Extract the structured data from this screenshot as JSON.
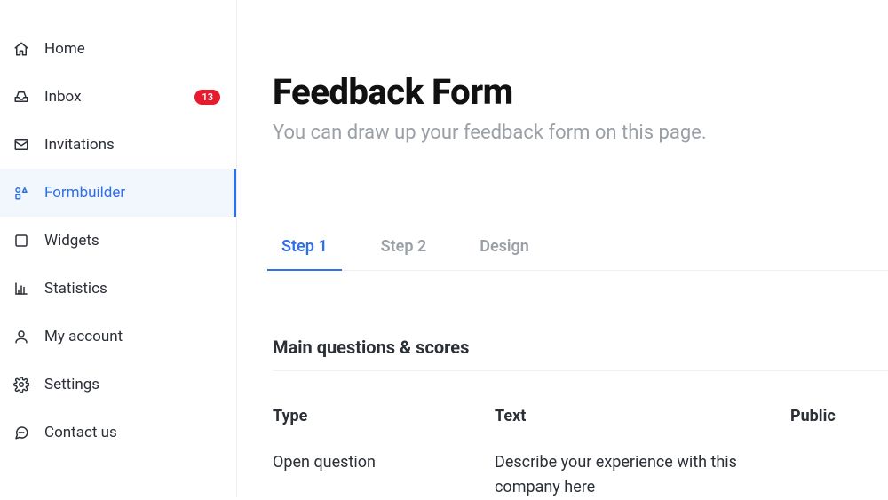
{
  "sidebar": {
    "items": [
      {
        "label": "Home",
        "icon": "home",
        "active": false
      },
      {
        "label": "Inbox",
        "icon": "inbox",
        "active": false,
        "badge": "13"
      },
      {
        "label": "Invitations",
        "icon": "envelope",
        "active": false
      },
      {
        "label": "Formbuilder",
        "icon": "shapes",
        "active": true
      },
      {
        "label": "Widgets",
        "icon": "square",
        "active": false
      },
      {
        "label": "Statistics",
        "icon": "bar-chart",
        "active": false
      },
      {
        "label": "My account",
        "icon": "user",
        "active": false
      },
      {
        "label": "Settings",
        "icon": "gear",
        "active": false
      },
      {
        "label": "Contact us",
        "icon": "chat",
        "active": false
      }
    ]
  },
  "page": {
    "title": "Feedback Form",
    "subtitle": "You can draw up your feedback form on this page."
  },
  "tabs": [
    {
      "label": "Step 1",
      "active": true
    },
    {
      "label": "Step 2",
      "active": false
    },
    {
      "label": "Design",
      "active": false
    }
  ],
  "questions": {
    "section_title": "Main questions & scores",
    "columns": {
      "type": "Type",
      "text": "Text",
      "public": "Public"
    },
    "rows": [
      {
        "type": "Open question",
        "text": "Describe your experience with this company here"
      }
    ]
  }
}
